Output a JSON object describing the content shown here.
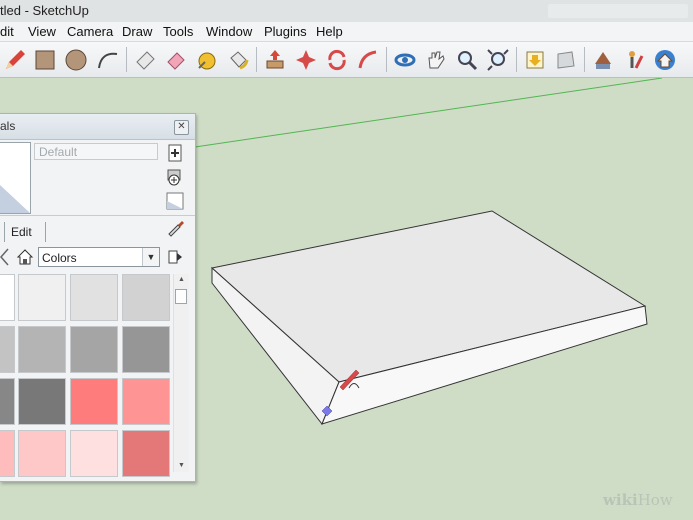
{
  "window": {
    "title": "tled - SketchUp"
  },
  "menu": [
    "dit",
    "View",
    "Camera",
    "Draw",
    "Tools",
    "Window",
    "Plugins",
    "Help"
  ],
  "toolbar": {
    "tools": [
      "pencil-tool-icon",
      "rectangle-tool-icon",
      "circle-tool-icon",
      "arc-tool-icon",
      "eraser-tool-icon",
      "paint-bucket-tool-icon",
      "tape-measure-tool-icon",
      "paint-tool-icon",
      "push-pull-tool-icon",
      "move-tool-icon",
      "rotate-tool-icon",
      "follow-me-tool-icon",
      "orbit-tool-icon",
      "pan-tool-icon",
      "zoom-tool-icon",
      "zoom-extents-tool-icon",
      "get-models-icon",
      "share-model-icon",
      "components-icon",
      "position-camera-icon",
      "walk-icon"
    ]
  },
  "materials_panel": {
    "title": "als",
    "name_placeholder": "Default",
    "tab_edit": "Edit",
    "collection": "Colors",
    "close_glyph": "✕",
    "combo_arrow": "▼",
    "scroll_up": "▲",
    "scroll_down": "▼",
    "swatch_colors": [
      [
        "#ffffff",
        "#f0f0f0",
        "#e1e1e1",
        "#d2d2d2"
      ],
      [
        "#c3c3c3",
        "#b4b4b4",
        "#a5a5a5",
        "#969696"
      ],
      [
        "#878787",
        "#787878",
        "#ff7c7c",
        "#ff9494"
      ],
      [
        "#ffbcbc",
        "#ffc8c8",
        "#ffe0e0",
        "#e47878"
      ]
    ]
  },
  "watermark": {
    "brand": "wiki",
    "suffix": "How"
  }
}
